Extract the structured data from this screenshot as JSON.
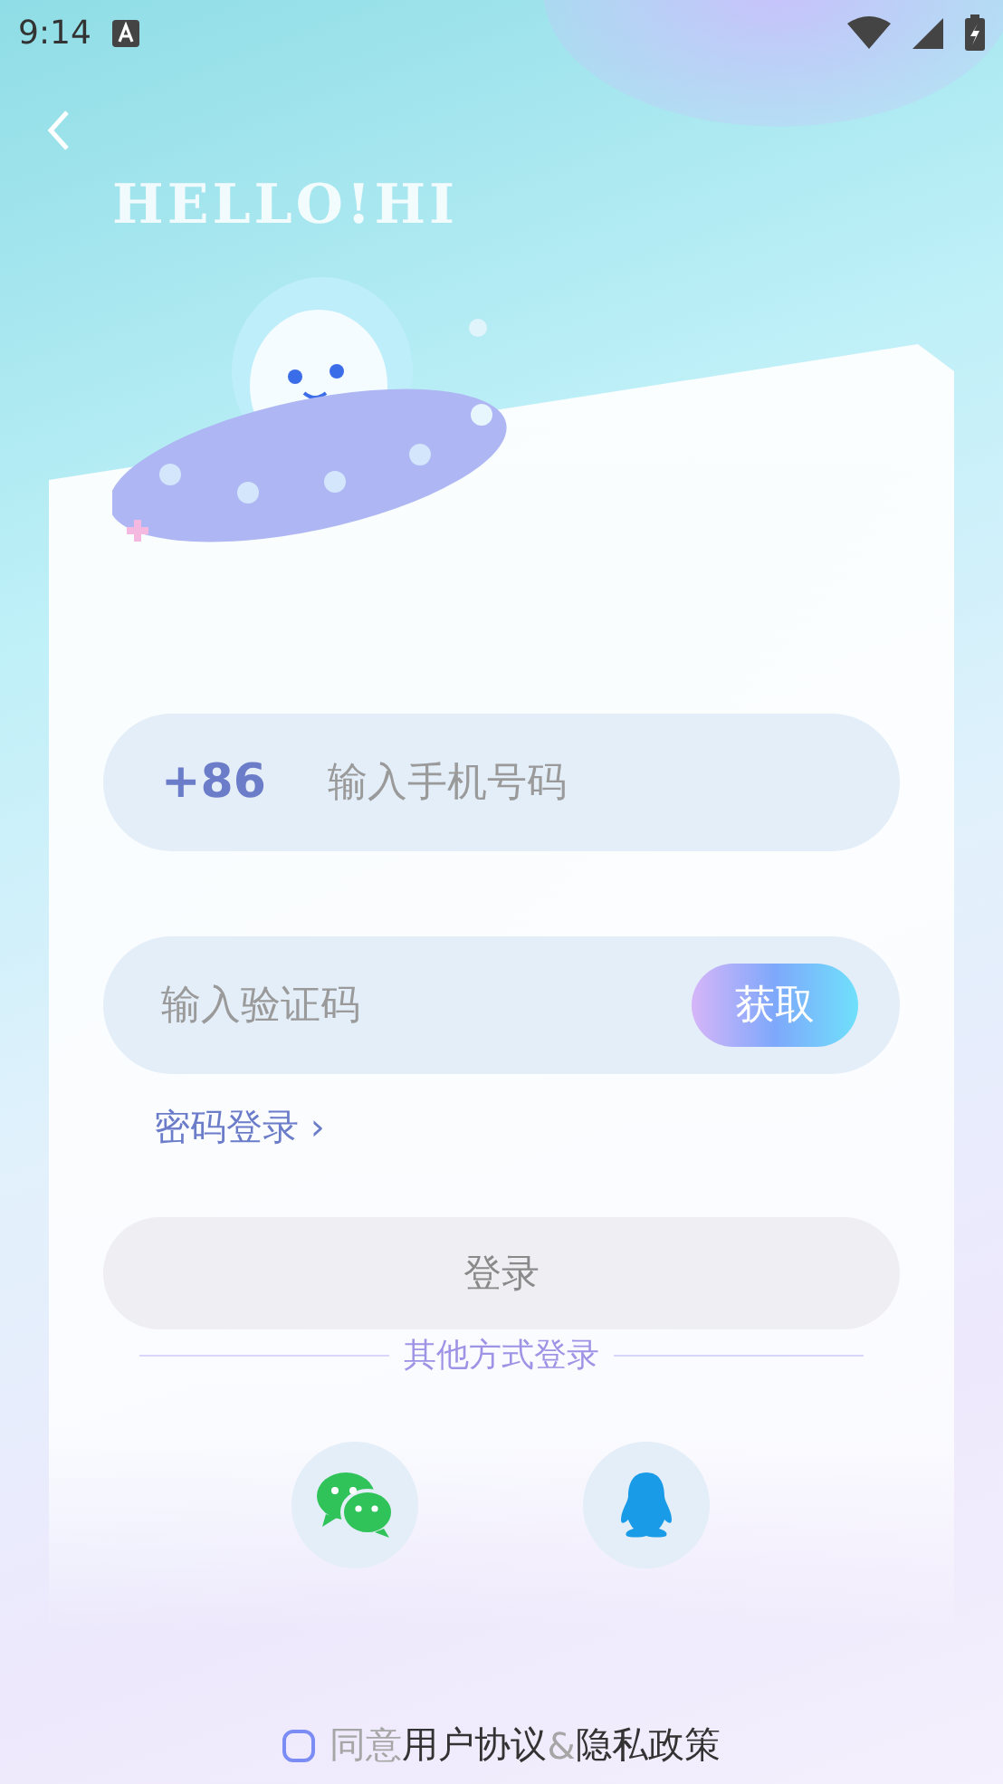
{
  "status_bar": {
    "time": "9:14"
  },
  "logo_text": "HELLO!HI",
  "phone_field": {
    "country_code": "+86",
    "placeholder": "输入手机号码"
  },
  "code_field": {
    "placeholder": "输入验证码",
    "button": "获取"
  },
  "password_login_link": "密码登录 ›",
  "login_button": {
    "label": "登录",
    "disabled": true
  },
  "other_methods": "其他方式登录",
  "social_logins": [
    {
      "kind": "wechat"
    },
    {
      "kind": "qq"
    }
  ],
  "agreement": {
    "checked": false,
    "prefix": "同意",
    "terms": "用户协议",
    "joiner": "&",
    "privacy": "隐私政策"
  }
}
